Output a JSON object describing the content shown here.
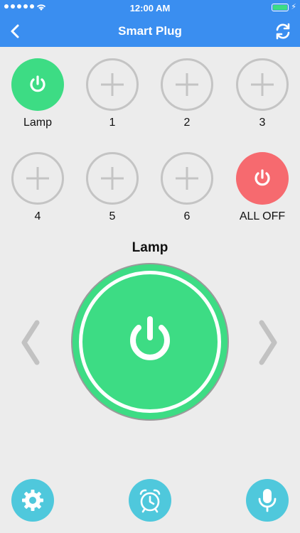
{
  "status_bar": {
    "time": "12:00 AM"
  },
  "header": {
    "title": "Smart Plug"
  },
  "plugs": [
    {
      "label": "Lamp",
      "state": "on"
    },
    {
      "label": "1",
      "state": "empty"
    },
    {
      "label": "2",
      "state": "empty"
    },
    {
      "label": "3",
      "state": "empty"
    },
    {
      "label": "4",
      "state": "empty"
    },
    {
      "label": "5",
      "state": "empty"
    },
    {
      "label": "6",
      "state": "empty"
    },
    {
      "label": "ALL OFF",
      "state": "off"
    }
  ],
  "selected_device": {
    "name": "Lamp"
  },
  "icons": {
    "back": "chevron-left-icon",
    "refresh": "refresh-icon",
    "power": "power-icon",
    "add": "plus-icon",
    "settings": "gear-icon",
    "timer": "alarm-clock-icon",
    "voice": "microphone-icon"
  },
  "colors": {
    "header": "#3a8ef0",
    "on": "#3ddc84",
    "off": "#f66a6f",
    "empty_border": "#c4c4c4",
    "bottom_button": "#4fc8dc",
    "background": "#ececec"
  }
}
